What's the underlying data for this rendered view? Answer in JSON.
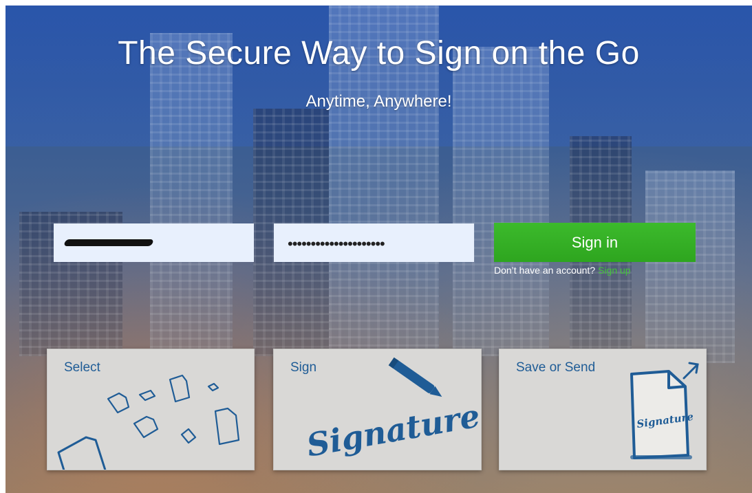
{
  "hero": {
    "title": "The Secure Way to Sign on the Go",
    "subtitle": "Anytime, Anywhere!"
  },
  "login": {
    "username_value": "",
    "password_mask": "•••••••••••••••••••••",
    "signin_label": "Sign in",
    "account_prompt": "Don’t have an account?",
    "signup_label": "Sign up"
  },
  "cards": [
    {
      "title": "Select",
      "icon": "documents-icon"
    },
    {
      "title": "Sign",
      "icon": "pen-signature-icon",
      "art_text": "Signature"
    },
    {
      "title": "Save or Send",
      "icon": "signed-document-arrow-icon",
      "art_text": "Signature"
    }
  ],
  "colors": {
    "accent_green": "#2ea51f",
    "link_green": "#43c43a",
    "card_blue": "#1f5c96",
    "field_bg": "#e8f0fd"
  }
}
